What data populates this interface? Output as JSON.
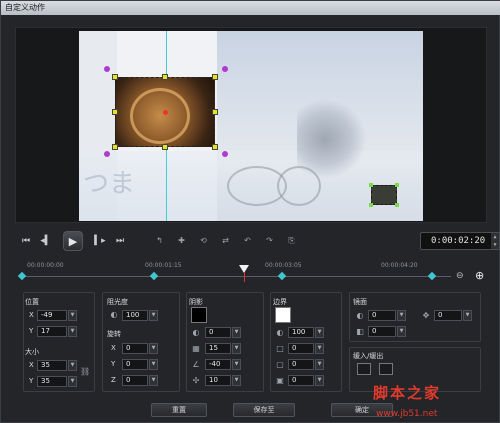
{
  "window": {
    "title": "自定义动作"
  },
  "preview": {
    "overlay_text": "つま"
  },
  "transport": {
    "icons": [
      "go-start-icon",
      "prev-frame-icon",
      "play-icon",
      "next-frame-icon",
      "go-end-icon"
    ],
    "timecode": "0:00:02:20"
  },
  "timeline": {
    "ticks": [
      "00:00:00:00",
      "00:00:01:15",
      "00:00:03:05",
      "00:00:04:20"
    ]
  },
  "position": {
    "title": "位置",
    "x_label": "X",
    "x_value": "-49",
    "y_label": "Y",
    "y_value": "17"
  },
  "size": {
    "title": "大小",
    "x_label": "X",
    "x_value": "35",
    "y_label": "Y",
    "y_value": "35"
  },
  "opacity": {
    "title": "阻光度",
    "value": "100"
  },
  "rotation": {
    "title": "旋转",
    "x_label": "X",
    "x_value": "0",
    "y_label": "Y",
    "y_value": "0",
    "z_label": "Z",
    "z_value": "0"
  },
  "shadow": {
    "title": "阴影",
    "color": "#000000",
    "v1": "0",
    "v2": "15",
    "v3": "-40",
    "v4": "10"
  },
  "border": {
    "title": "边界",
    "color": "#ffffff",
    "v1": "100",
    "v2": "0",
    "v3": "0",
    "v4": "0"
  },
  "mirror": {
    "title": "镜面",
    "v1": "0",
    "v2": "0",
    "v3": "0"
  },
  "fade": {
    "title": "缓入/缓出"
  },
  "buttons": {
    "reset": "重置",
    "save_as": "保存至",
    "ok": "确定"
  },
  "watermark": {
    "line1": "脚本之家",
    "line2": "www.jb51.net"
  }
}
